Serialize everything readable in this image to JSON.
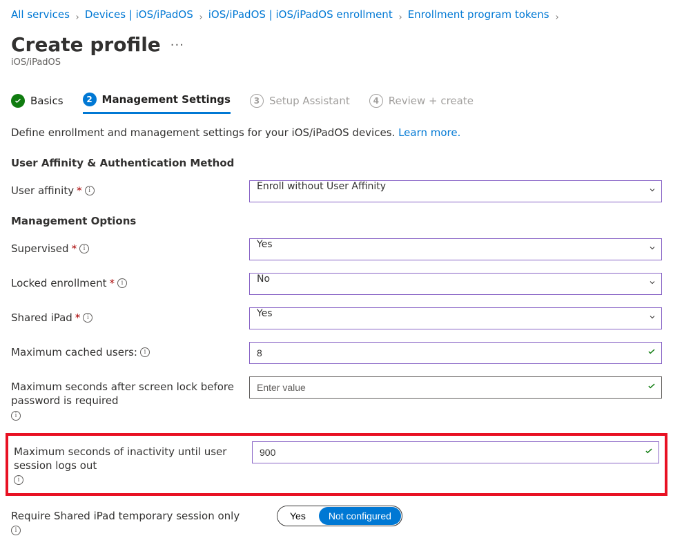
{
  "breadcrumb": {
    "items": [
      {
        "label": "All services"
      },
      {
        "label": "Devices | iOS/iPadOS"
      },
      {
        "label": "iOS/iPadOS | iOS/iPadOS enrollment"
      },
      {
        "label": "Enrollment program tokens"
      }
    ]
  },
  "page": {
    "title": "Create profile",
    "subtitle": "iOS/iPadOS"
  },
  "tabs": {
    "t1": {
      "num": "✓",
      "label": "Basics"
    },
    "t2": {
      "num": "2",
      "label": "Management Settings"
    },
    "t3": {
      "num": "3",
      "label": "Setup Assistant"
    },
    "t4": {
      "num": "4",
      "label": "Review + create"
    }
  },
  "description": {
    "text": "Define enrollment and management settings for your iOS/iPadOS devices.",
    "learn_more": "Learn more."
  },
  "sections": {
    "user_affinity": "User Affinity & Authentication Method",
    "management_options": "Management Options"
  },
  "fields": {
    "user_affinity": {
      "label": "User affinity",
      "required": "*",
      "value": "Enroll without User Affinity"
    },
    "supervised": {
      "label": "Supervised",
      "required": "*",
      "value": "Yes"
    },
    "locked_enrollment": {
      "label": "Locked enrollment",
      "required": "*",
      "value": "No"
    },
    "shared_ipad": {
      "label": "Shared iPad",
      "required": "*",
      "value": "Yes"
    },
    "max_cached_users": {
      "label": "Maximum cached users:",
      "value": "8"
    },
    "max_seconds_lock": {
      "label": "Maximum seconds after screen lock before password is required",
      "placeholder": "Enter value",
      "value": ""
    },
    "max_inactivity": {
      "label": "Maximum seconds of inactivity until user session logs out",
      "value": "900"
    },
    "require_temp_session": {
      "label": "Require Shared iPad temporary session only",
      "opt_yes": "Yes",
      "opt_notconf": "Not configured"
    }
  },
  "icons": {
    "info": "i"
  }
}
